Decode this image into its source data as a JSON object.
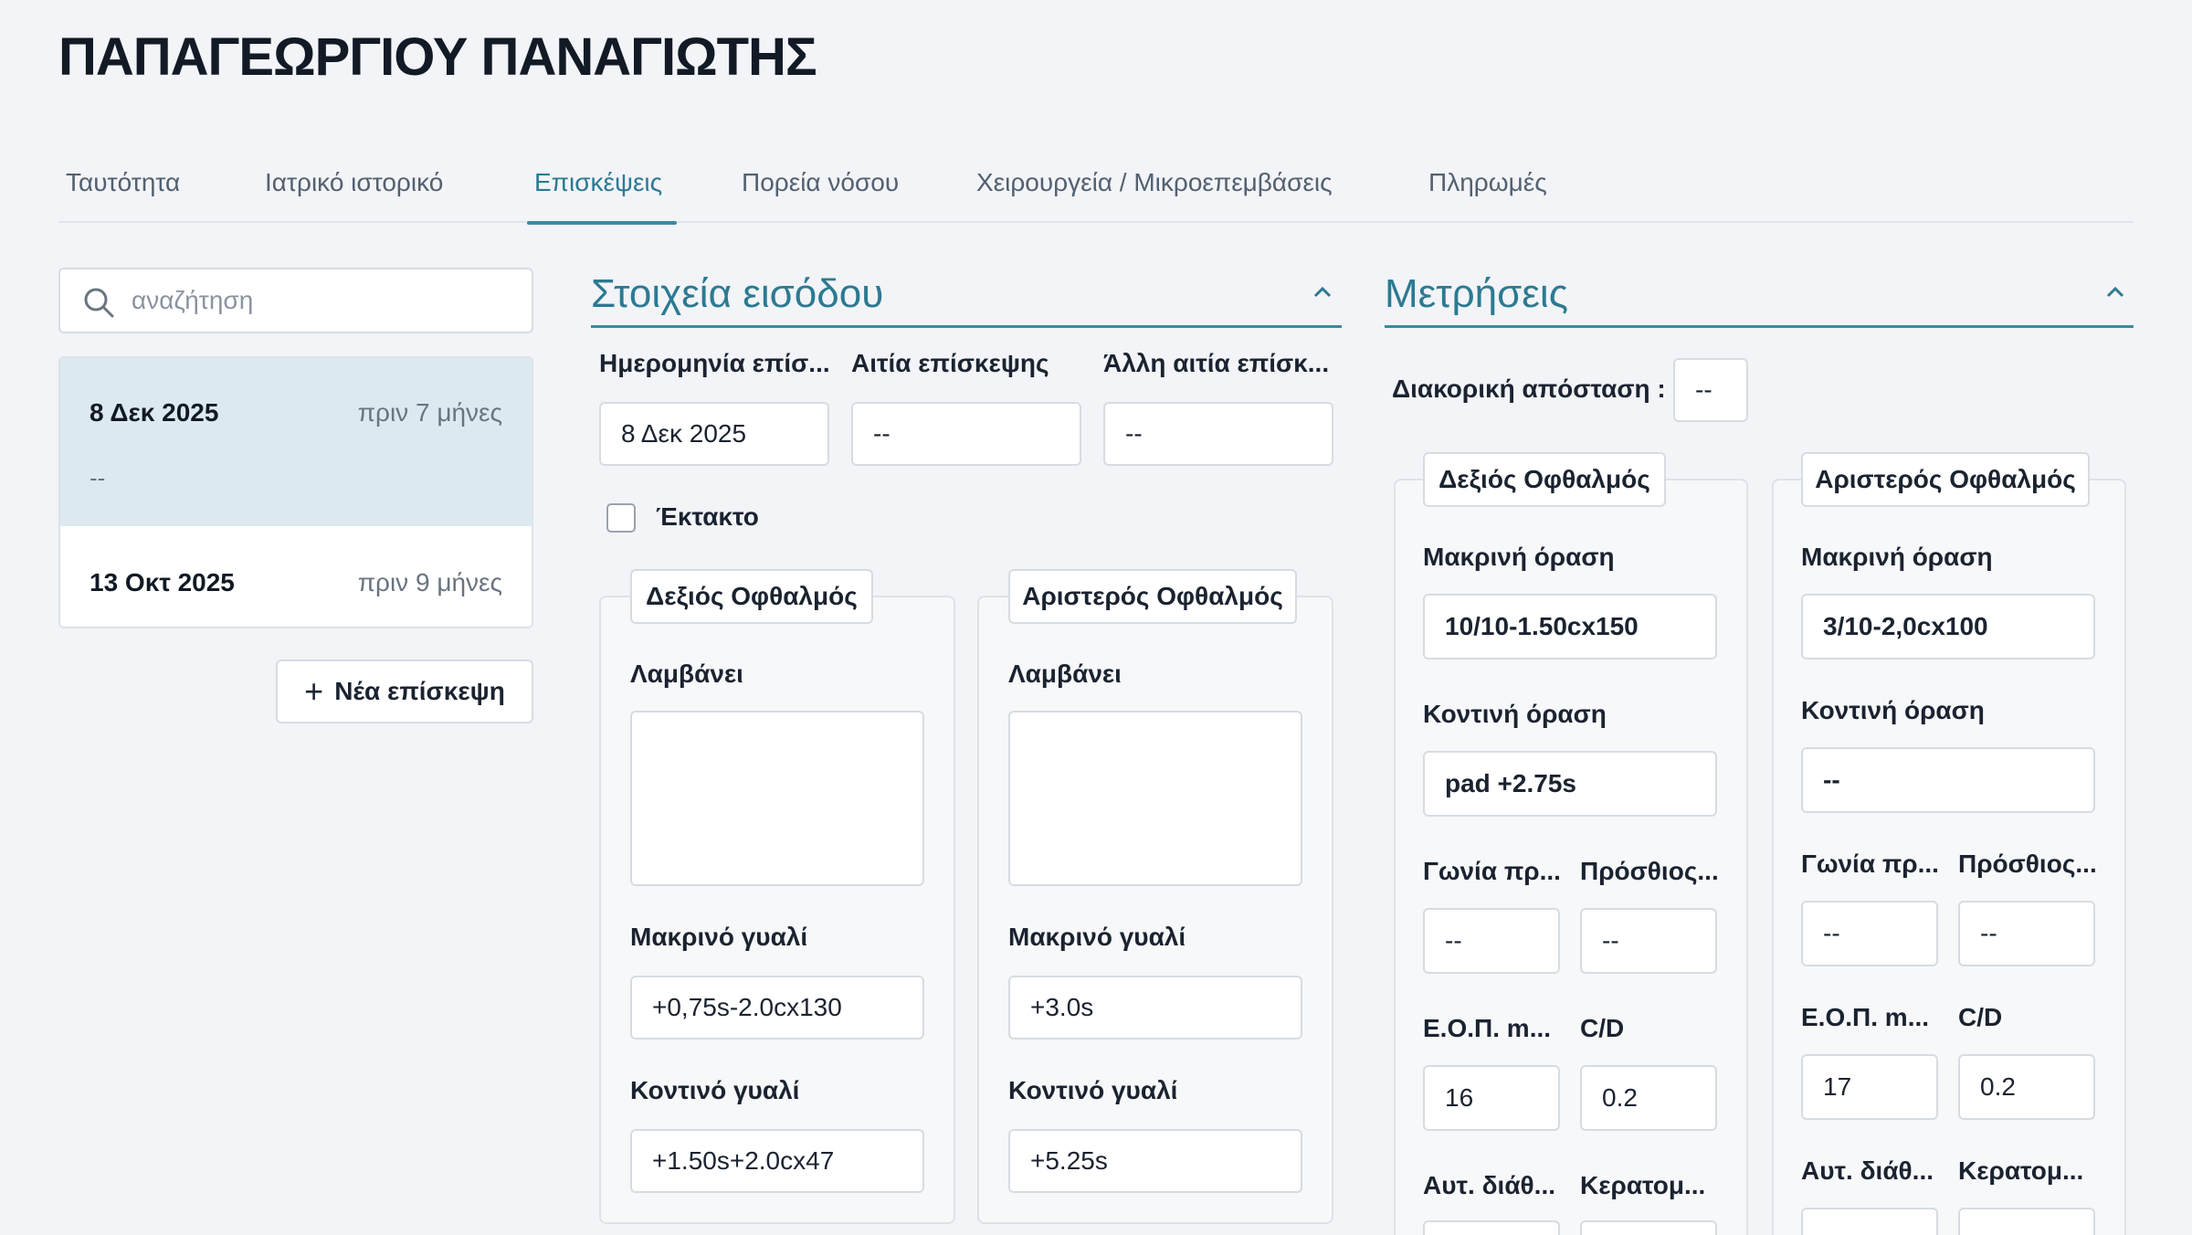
{
  "patient": {
    "name": "ΠΑΠΑΓΕΩΡΓΙΟΥ ΠΑΝΑΓΙΩΤΗΣ"
  },
  "tabs": [
    {
      "label": "Ταυτότητα"
    },
    {
      "label": "Ιατρικό ιστορικό"
    },
    {
      "label": "Επισκέψεις"
    },
    {
      "label": "Πορεία νόσου"
    },
    {
      "label": "Χειρουργεία / Μικροεπεμβάσεις"
    },
    {
      "label": "Πληρωμές"
    }
  ],
  "active_tab": "Επισκέψεις",
  "search": {
    "placeholder": "αναζήτηση",
    "value": ""
  },
  "visits": [
    {
      "date": "8 Δεκ 2025",
      "ago": "πριν 7 μήνες",
      "sub": "--",
      "selected": true
    },
    {
      "date": "13 Οκτ 2025",
      "ago": "πριν 9 μήνες"
    }
  ],
  "new_visit_label": "Νέα επίσκεψη",
  "entry": {
    "heading": "Στοιχεία εισόδου",
    "date_label": "Ημερομηνία επίσ...",
    "date_value": "8 Δεκ 2025",
    "reason_label": "Αιτία επίσκεψης",
    "reason_value": "--",
    "other_reason_label": "Άλλη αιτία επίσκ...",
    "other_reason_value": "--",
    "urgent_label": "Έκτακτο",
    "urgent_checked": false,
    "right": {
      "title": "Δεξιός Οφθαλμός",
      "takes_label": "Λαμβάνει",
      "takes_value": "",
      "far_label": "Μακρινό γυαλί",
      "far_value": "+0,75s-2.0cx130",
      "near_label": "Κοντινό γυαλί",
      "near_value": "+1.50s+2.0cx47"
    },
    "left": {
      "title": "Αριστερός Οφθαλμός",
      "takes_label": "Λαμβάνει",
      "takes_value": "",
      "far_label": "Μακρινό γυαλί",
      "far_value": "+3.0s",
      "near_label": "Κοντινό γυαλί",
      "near_value": "+5.25s"
    }
  },
  "measurements": {
    "heading": "Μετρήσεις",
    "pd_label": "Διακορική απόσταση :",
    "pd_value": "--",
    "right": {
      "title": "Δεξιός Οφθαλμός",
      "far_label": "Μακρινή όραση",
      "far_value": "10/10-1.50cx150",
      "near_label": "Κοντινή όραση",
      "near_value": "pad +2.75s",
      "angle_label": "Γωνία πρ...",
      "angle_value": "--",
      "anterior_label": "Πρόσθιος...",
      "anterior_value": "--",
      "iop_label": "Ε.Ο.Π. m...",
      "iop_value": "16",
      "cd_label": "C/D",
      "cd_value": "0.2",
      "auto_label": "Αυτ. διάθ...",
      "kerat_label": "Κερατομ..."
    },
    "left": {
      "title": "Αριστερός Οφθαλμός",
      "far_label": "Μακρινή όραση",
      "far_value": "3/10-2,0cx100",
      "near_label": "Κοντινή όραση",
      "near_value": "--",
      "angle_label": "Γωνία πρ...",
      "angle_value": "--",
      "anterior_label": "Πρόσθιος...",
      "anterior_value": "--",
      "iop_label": "Ε.Ο.Π. m...",
      "iop_value": "17",
      "cd_label": "C/D",
      "cd_value": "0.2",
      "auto_label": "Αυτ. διάθ...",
      "kerat_label": "Κερατομ..."
    }
  }
}
